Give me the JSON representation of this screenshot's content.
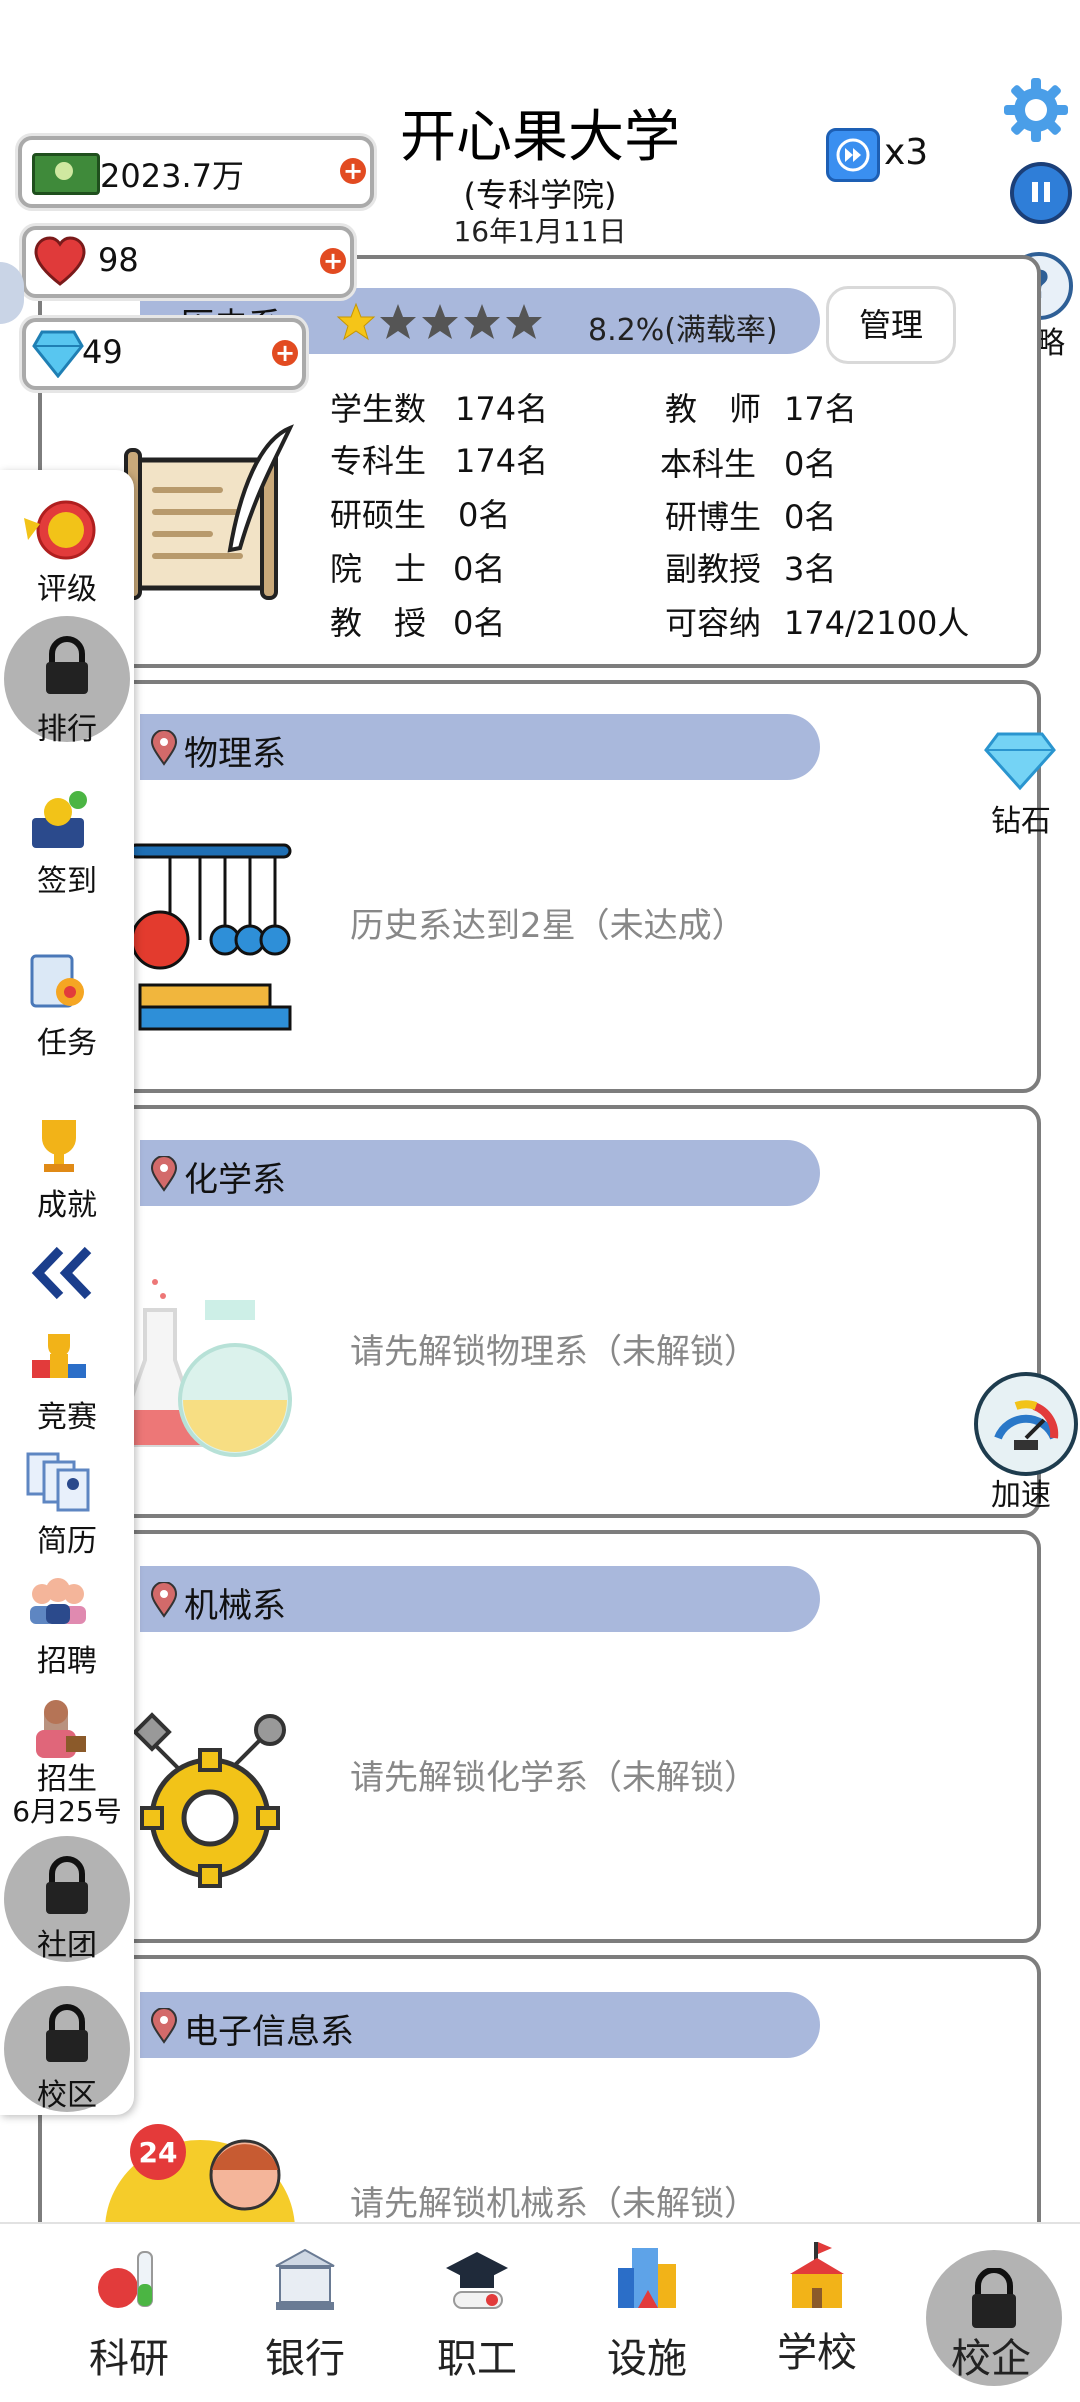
{
  "header": {
    "title": "开心果大学",
    "subtitle": "(专科学院)",
    "date": "16年1月11日",
    "speed": "x3"
  },
  "resources": {
    "money": "2023.7万",
    "hearts": "98",
    "diamonds": "49"
  },
  "top_right": {
    "guide_label": "攻略"
  },
  "history_dept": {
    "name": "历史系",
    "stars_filled": 1,
    "stars_total": 5,
    "load_rate": "8.2%(满载率)",
    "manage_label": "管理",
    "stats": [
      {
        "label": "学生数",
        "value": "174名"
      },
      {
        "label": "教　师",
        "value": "17名"
      },
      {
        "label": "专科生",
        "value": "174名"
      },
      {
        "label": "本科生",
        "value": "0名"
      },
      {
        "label": "研硕生",
        "value": "0名"
      },
      {
        "label": "研博生",
        "value": "0名"
      },
      {
        "label": "院　士",
        "value": "0名"
      },
      {
        "label": "副教授",
        "value": "3名"
      },
      {
        "label": "教　授",
        "value": "0名"
      },
      {
        "label": "可容纳",
        "value": "174/2100人"
      }
    ]
  },
  "departments": [
    {
      "name": "物理系",
      "status": "历史系达到2星（未达成）"
    },
    {
      "name": "化学系",
      "status": "请先解锁物理系（未解锁）"
    },
    {
      "name": "机械系",
      "status": "请先解锁化学系（未解锁）"
    },
    {
      "name": "电子信息系",
      "status": "请先解锁机械系（未解锁）"
    }
  ],
  "sidebar": {
    "items": [
      {
        "label": "评级"
      },
      {
        "label": "排行"
      },
      {
        "label": "签到"
      },
      {
        "label": "任务"
      },
      {
        "label": "成就"
      },
      {
        "label": "竞赛"
      },
      {
        "label": "简历"
      },
      {
        "label": "招聘"
      },
      {
        "label": "招生"
      },
      {
        "label": "社团"
      },
      {
        "label": "校区"
      }
    ],
    "enroll_date": "6月25号"
  },
  "right_side": {
    "diamond_label": "钻石",
    "speedup_label": "加速"
  },
  "bottom_nav": {
    "tabs": [
      {
        "label": "科研"
      },
      {
        "label": "银行"
      },
      {
        "label": "职工"
      },
      {
        "label": "设施"
      },
      {
        "label": "学校"
      },
      {
        "label": "校企"
      }
    ]
  },
  "colors": {
    "dept_bar": "#a9b8dc",
    "card_border": "#7d7d7d",
    "lock_text": "#888888",
    "plus": "#e24b21"
  }
}
